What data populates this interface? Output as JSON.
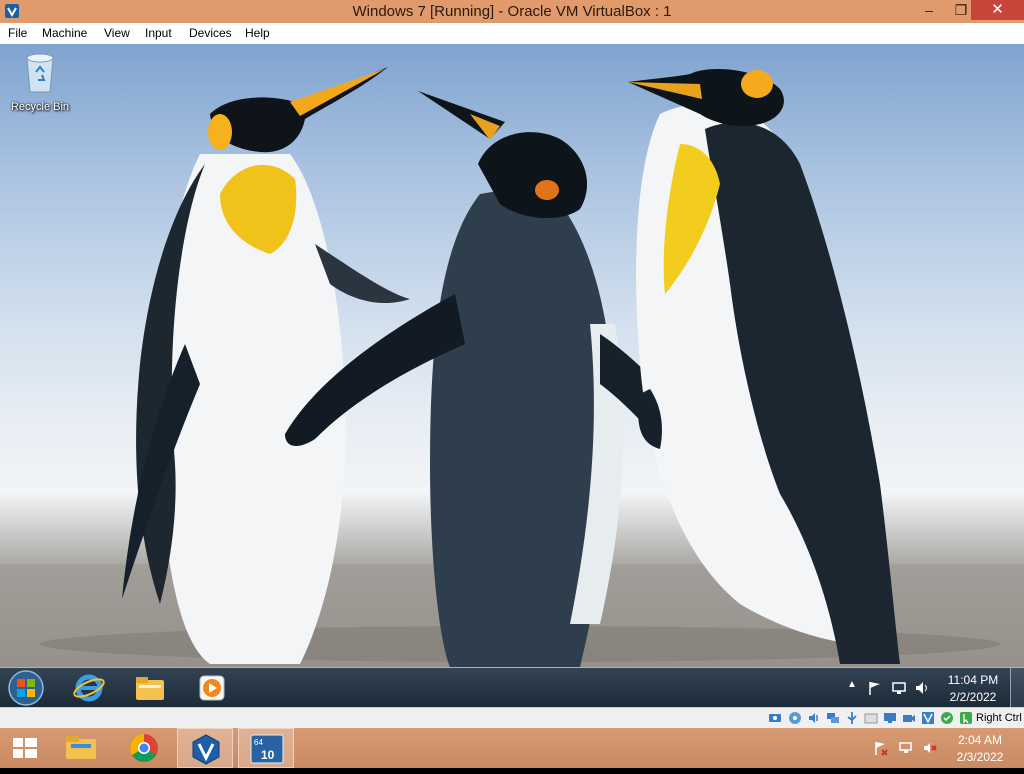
{
  "window": {
    "title": "Windows 7 [Running] - Oracle VM VirtualBox : 1"
  },
  "window_controls": {
    "minimize": "–",
    "maximize": "❐",
    "close": "✕"
  },
  "menubar": {
    "items": [
      "File",
      "Machine",
      "View",
      "Input",
      "Devices",
      "Help"
    ]
  },
  "guest": {
    "desktop_icons": [
      {
        "label": "Recycle Bin",
        "icon": "recycle-bin-icon"
      }
    ],
    "taskbar": {
      "pinned": [
        "internet-explorer-icon",
        "windows-explorer-icon",
        "media-player-icon"
      ],
      "clock": {
        "time": "11:04 PM",
        "date": "2/2/2022"
      },
      "tray_icons": [
        "show-hidden-icons-icon",
        "action-center-flag-icon",
        "network-icon",
        "volume-icon"
      ]
    }
  },
  "vbox_status": {
    "host_key": "Right Ctrl"
  },
  "host": {
    "taskbar": {
      "apps": [
        "file-explorer-icon",
        "chrome-icon",
        "virtualbox-icon",
        "virtualbox-win10-icon"
      ],
      "clock": {
        "time": "2:04 AM",
        "date": "2/3/2022"
      }
    }
  },
  "colors": {
    "titlebar": "#e09a6b",
    "close": "#c7463a",
    "host_taskbar": "#d79a73"
  }
}
